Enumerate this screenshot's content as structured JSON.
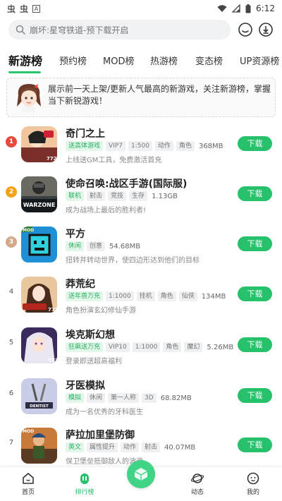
{
  "status_bar": {
    "time": "6:12",
    "left_glyphs": [
      "虫",
      "虫"
    ],
    "notif_letter": "A"
  },
  "search": {
    "placeholder": "崩坏:星穹铁道-预下载开启"
  },
  "tabs": [
    {
      "label": "新游榜"
    },
    {
      "label": "预约榜"
    },
    {
      "label": "MOD榜"
    },
    {
      "label": "热游榜"
    },
    {
      "label": "变态榜"
    },
    {
      "label": "UP资源榜"
    }
  ],
  "banner": {
    "text": "展示前一天上架/更新人气最高的新游戏，关注新游榜，掌握当下新锐游戏！"
  },
  "games": [
    {
      "rank": "1",
      "name": "奇门之上",
      "tags": [
        {
          "t": "送高体游戏",
          "g": true
        },
        {
          "t": "VIP7",
          "g": false
        },
        {
          "t": "1:500",
          "g": false
        },
        {
          "t": "动作",
          "g": false
        },
        {
          "t": "角色",
          "g": false
        }
      ],
      "size": "368MB",
      "desc": "上线送GM工具，免费激活首充",
      "button": "下载",
      "icon_text": "7723"
    },
    {
      "rank": "2",
      "name": "使命召唤:战区手游(国际服)",
      "tags": [
        {
          "t": "联机",
          "g": true
        },
        {
          "t": "射击",
          "g": false
        },
        {
          "t": "竞技",
          "g": false
        },
        {
          "t": "生存",
          "g": false
        }
      ],
      "size": "1.13GB",
      "desc": "成为战场上最后的胜利者!",
      "button": "下载",
      "icon_text": "WARZONE"
    },
    {
      "rank": "3",
      "name": "平方",
      "tags": [
        {
          "t": "休闲",
          "g": true
        },
        {
          "t": "创意",
          "g": false
        }
      ],
      "size": "54.68MB",
      "desc": "扭转并转动世界，使四边形达到他们的目标",
      "button": "下载",
      "icon_text": "MOD"
    },
    {
      "rank": "4",
      "name": "莽荒纪",
      "tags": [
        {
          "t": "送年兽万充",
          "g": true
        },
        {
          "t": "1:1000",
          "g": false
        },
        {
          "t": "挂机",
          "g": false
        },
        {
          "t": "角色",
          "g": false
        },
        {
          "t": "仙侠",
          "g": false
        }
      ],
      "size": "134MB",
      "desc": "角色扮演玄幻修仙手游",
      "button": "下载",
      "icon_text": "7723"
    },
    {
      "rank": "5",
      "name": "埃克斯幻想",
      "tags": [
        {
          "t": "狂飙送万充",
          "g": true
        },
        {
          "t": "VIP10",
          "g": false
        },
        {
          "t": "1:1000",
          "g": false
        },
        {
          "t": "角色",
          "g": false
        },
        {
          "t": "魔幻",
          "g": false
        }
      ],
      "size": "5.26MB",
      "desc": "登录即送超高福利",
      "button": "下载",
      "icon_text": "7723"
    },
    {
      "rank": "6",
      "name": "牙医模拟",
      "tags": [
        {
          "t": "模拟",
          "g": true
        },
        {
          "t": "休闲",
          "g": false
        },
        {
          "t": "第一人称",
          "g": false
        },
        {
          "t": "3D",
          "g": false
        }
      ],
      "size": "68.82MB",
      "desc": "成为一名优秀的牙科医生",
      "button": "下载",
      "icon_text": "DENTIST"
    },
    {
      "rank": "7",
      "name": "萨拉加里堡防御",
      "tags": [
        {
          "t": "英文",
          "g": true
        },
        {
          "t": "属性提升",
          "g": false
        },
        {
          "t": "动作",
          "g": false
        },
        {
          "t": "射击",
          "g": false
        }
      ],
      "size": "40.07MB",
      "desc": "保卫堡垒抵御敌人的波浪。",
      "button": "下载",
      "icon_text": "MOD"
    }
  ],
  "bottom_nav": {
    "items": [
      {
        "label": "首页"
      },
      {
        "label": "排行榜"
      },
      {
        "label": "动态"
      },
      {
        "label": "我的"
      }
    ]
  },
  "colors": {
    "accent": "#27c06b",
    "rank1": "#e64a3c",
    "rank2": "#f3a21b",
    "rank3": "#d3a98c"
  }
}
